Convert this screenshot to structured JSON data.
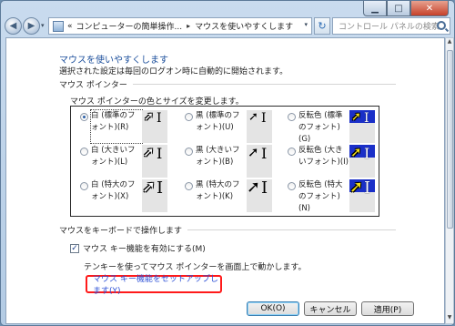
{
  "window": {
    "controls": {
      "minimize": "▁",
      "maximize": "□",
      "close": "✕"
    }
  },
  "nav": {
    "back_glyph": "◀",
    "forward_glyph": "▶",
    "dropdown_glyph": "▾",
    "breadcrumb_prefix": "«",
    "breadcrumb": [
      "コンピューターの簡単操作...",
      "マウスを使いやすくします"
    ],
    "breadcrumb_sep": "▸",
    "refresh_glyph": "↻",
    "search_placeholder": "コントロール パネルの検索"
  },
  "page": {
    "heading": "マウスを使いやすくします",
    "description": "選択された設定は毎回のログオン時に自動的に開始されます。",
    "pointer_section": "マウス ポインター",
    "pointer_desc": "マウス ポインターの色とサイズを変更します。",
    "schemes": [
      {
        "label": "白 (標準のフォント)(R)",
        "selected": true,
        "style": "white",
        "size": "normal"
      },
      {
        "label": "黒 (標準のフォント)(U)",
        "selected": false,
        "style": "black",
        "size": "normal"
      },
      {
        "label": "反転色 (標準のフォント)(G)",
        "selected": false,
        "style": "inverted",
        "size": "normal"
      },
      {
        "label": "白 (大きいフォント)(L)",
        "selected": false,
        "style": "white",
        "size": "large"
      },
      {
        "label": "黒 (大きいフォント)(B)",
        "selected": false,
        "style": "black",
        "size": "large"
      },
      {
        "label": "反転色 (大きいフォント)(I)",
        "selected": false,
        "style": "inverted",
        "size": "large"
      },
      {
        "label": "白 (特大のフォント)(X)",
        "selected": false,
        "style": "white",
        "size": "xlarge"
      },
      {
        "label": "黒 (特大のフォント)(K)",
        "selected": false,
        "style": "black",
        "size": "xlarge"
      },
      {
        "label": "反転色 (特大のフォント)(N)",
        "selected": false,
        "style": "inverted",
        "size": "xlarge"
      }
    ],
    "keyboard_section": "マウスをキーボードで操作します",
    "mouse_keys_label": "マウス キー機能を有効にする(M)",
    "mouse_keys_checked": "✓",
    "mouse_keys_note": "テンキーを使ってマウス ポインターを画面上で動かします。",
    "setup_link": "マウス キー機能をセットアップします(Y)"
  },
  "buttons": {
    "ok": "OK(O)",
    "cancel": "キャンセル",
    "apply": "適用(P)"
  },
  "colors": {
    "accent": "#1c4f9c",
    "link": "#2b4fd6",
    "highlight_border": "#ff1a1a",
    "inverted_blue": "#1a2fc8"
  }
}
